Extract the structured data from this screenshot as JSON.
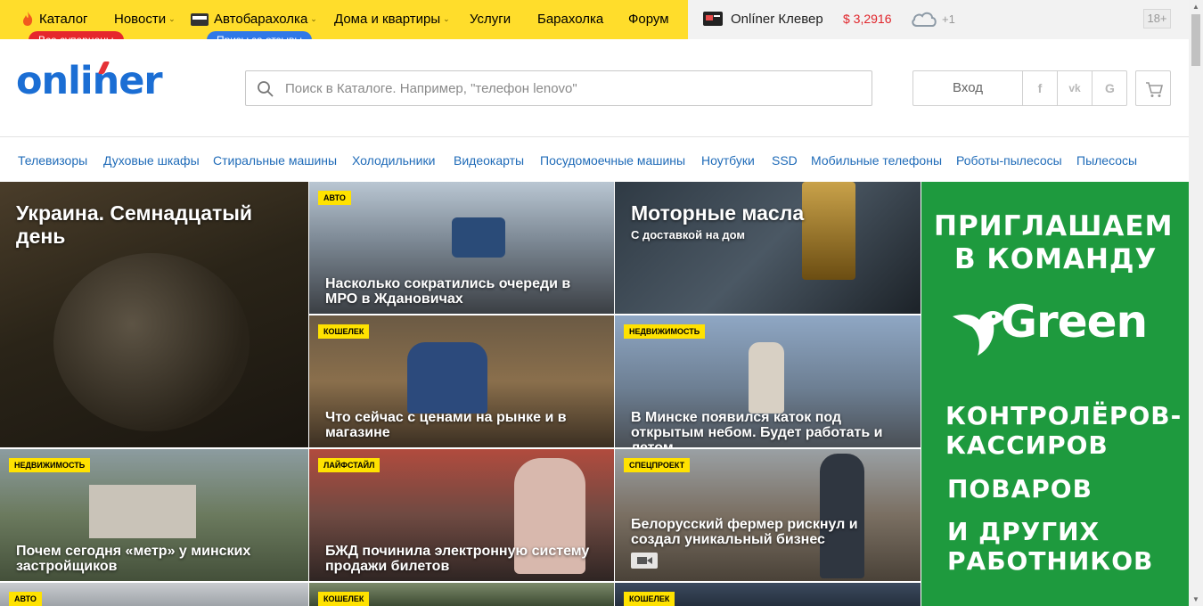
{
  "topnav": {
    "items": [
      {
        "label": "Каталог",
        "has_caret": false
      },
      {
        "label": "Новости",
        "has_caret": true
      },
      {
        "label": "Автобарахолка",
        "has_caret": true
      },
      {
        "label": "Дома и квартиры",
        "has_caret": true
      },
      {
        "label": "Услуги",
        "has_caret": false
      },
      {
        "label": "Барахолка",
        "has_caret": false
      },
      {
        "label": "Форум",
        "has_caret": false
      }
    ],
    "pill_superprices": "Все суперцены",
    "pill_reviews": "Призы за отзывы",
    "clever": "Onlíner Клевер",
    "currency": "$ 3,2916",
    "weather": "+1",
    "age": "18+",
    "caret": "⌄"
  },
  "header": {
    "logo": "onliner",
    "search_placeholder": "Поиск в Каталоге. Например, \"телефон lenovo\"",
    "login": "Вход",
    "social": [
      "f",
      "vk",
      "G"
    ]
  },
  "categories": [
    "Телевизоры",
    "Духовые шкафы",
    "Стиральные машины",
    "Холодильники",
    "Видеокарты",
    "Посудомоечные машины",
    "Ноутбуки",
    "SSD",
    "Мобильные телефоны",
    "Роботы-пылесосы",
    "Пылесосы"
  ],
  "tiles": {
    "t1": {
      "title": "Украина. Семнадцатый день"
    },
    "t2": {
      "tag": "АВТО",
      "title": "Насколько сократились очереди в МРО в Ждановичах"
    },
    "t3": {
      "title": "Моторные масла",
      "sub": "С доставкой на дом"
    },
    "t4": {
      "tag": "КОШЕЛЕК",
      "title": "Что сейчас с ценами на рынке и в магазине"
    },
    "t5": {
      "tag": "НЕДВИЖИМОСТЬ",
      "title": "В Минске появился каток под открытым небом. Будет работать и летом"
    },
    "t6": {
      "tag": "НЕДВИЖИМОСТЬ",
      "title": "Почем сегодня «метр» у минских застройщиков"
    },
    "t7": {
      "tag": "ЛАЙФСТАЙЛ",
      "title": "БЖД починила электронную систему продажи билетов"
    },
    "t8": {
      "tag": "СПЕЦПРОЕКТ",
      "title": "Белорусский фермер рискнул и создал уникальный бизнес"
    },
    "t9": {
      "tag": "АВТО"
    },
    "t10": {
      "tag": "КОШЕЛЕК"
    },
    "t11": {
      "tag": "КОШЕЛЕК"
    }
  },
  "ad": {
    "l1": "ПРИГЛАШАЕМ",
    "l2": "В КОМАНДУ",
    "brand": "Green",
    "l3": "КОНТРОЛЁРОВ-",
    "l4": "КАССИРОВ",
    "l5": "ПОВАРОВ",
    "l6": "И ДРУГИХ",
    "l7": "РАБОТНИКОВ"
  },
  "colors": {
    "yellow": "#ffdd2b",
    "brand_blue": "#1b6ed4",
    "red_pill": "#e6272c",
    "blue_pill": "#2f78e8",
    "ad_green": "#1e9a3e",
    "tag_yellow": "#ffe200",
    "link": "#1f6bb8"
  }
}
